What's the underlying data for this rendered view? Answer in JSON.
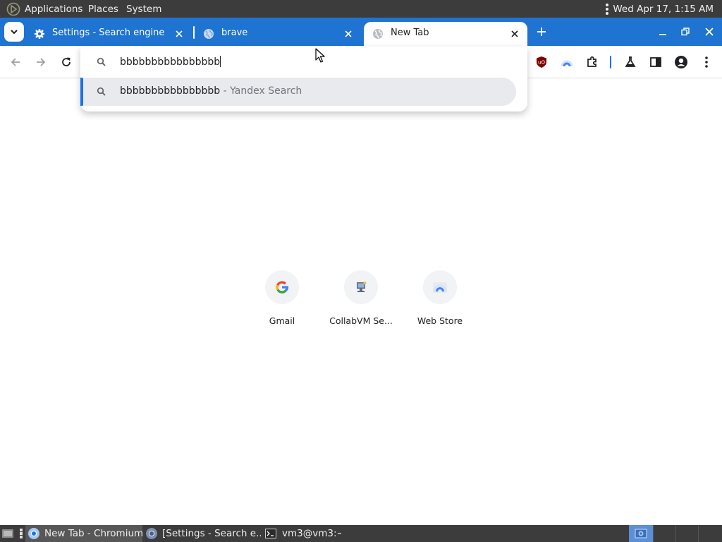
{
  "system_panel": {
    "menus": [
      "Applications",
      "Places",
      "System"
    ],
    "clock": "Wed Apr 17,  1:15 AM"
  },
  "browser": {
    "tabs": [
      {
        "title": "Settings - Search engine",
        "icon": "gear-icon",
        "active": false
      },
      {
        "title": "brave",
        "icon": "globe-icon",
        "active": false
      },
      {
        "title": "New Tab",
        "icon": "globe-icon",
        "active": true
      }
    ],
    "omnibox": {
      "query": "bbbbbbbbbbbbbbbb",
      "suggestion": {
        "text": "bbbbbbbbbbbbbbbb",
        "description": " - Yandex Search"
      }
    },
    "shortcuts": [
      {
        "label": "Gmail",
        "icon": "google-icon"
      },
      {
        "label": "CollabVM Se...",
        "icon": "collabvm-icon"
      },
      {
        "label": "Web Store",
        "icon": "webstore-icon"
      }
    ],
    "accent_color": "#1f73d1"
  },
  "taskbar": {
    "items": [
      {
        "label": "New Tab - Chromium",
        "active": true
      },
      {
        "label": "[Settings - Search e...",
        "active": false
      },
      {
        "label": "vm3@vm3:~",
        "active": false
      }
    ]
  }
}
